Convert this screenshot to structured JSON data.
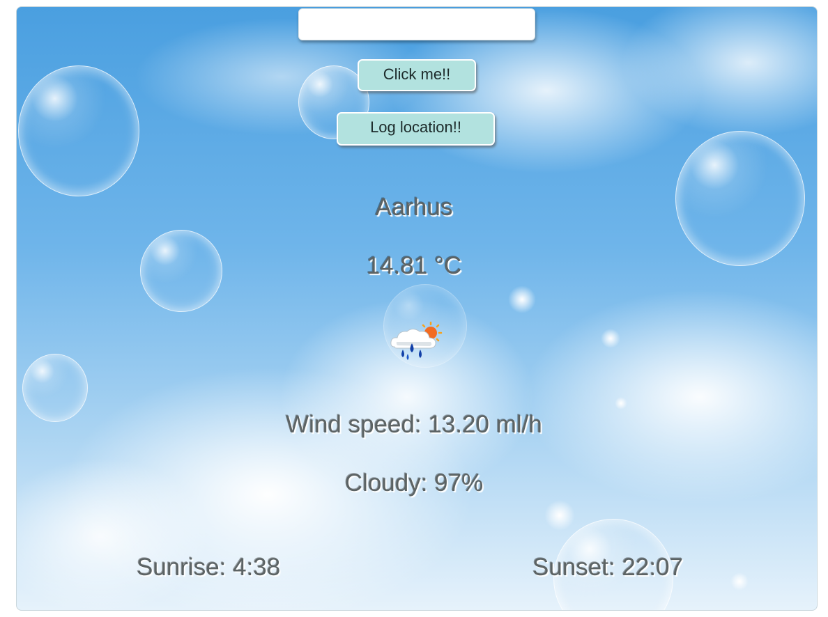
{
  "search": {
    "value": "",
    "placeholder": ""
  },
  "buttons": {
    "click_label": "Click me!!",
    "log_label": "Log location!!"
  },
  "weather": {
    "city": "Aarhus",
    "temperature": "14.81 °C",
    "icon": "rain-cloud-sun-icon",
    "wind_speed": "Wind speed: 13.20 ml/h",
    "cloudy": "Cloudy: 97%",
    "sunrise": "Sunrise: 4:38",
    "sunset": "Sunset: 22:07"
  },
  "colors": {
    "button_bg": "#b2e2df",
    "text": "#5c6364",
    "sky_top": "#4a9fe0"
  }
}
